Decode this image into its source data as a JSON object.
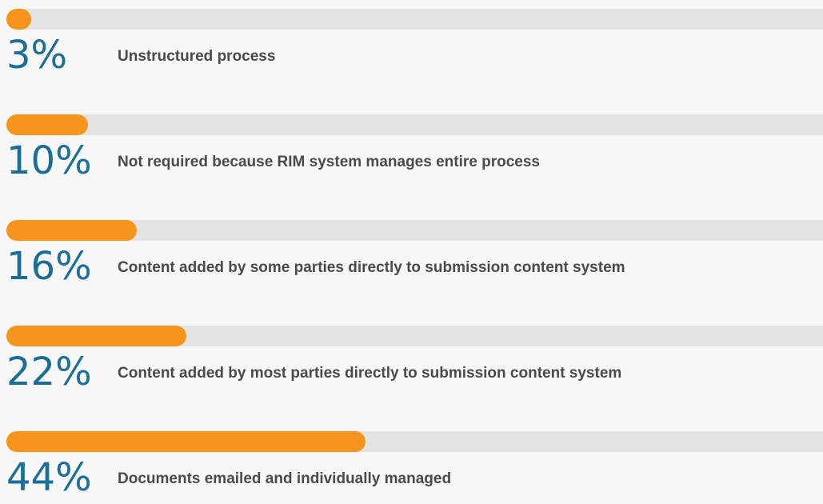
{
  "chart_data": {
    "type": "bar",
    "orientation": "horizontal",
    "categories": [
      "Unstructured process",
      "Not required because RIM system manages entire process",
      "Content added by some parties directly to submission content system",
      "Content added by most parties directly to submission content system",
      "Documents emailed and individually managed"
    ],
    "values": [
      3,
      10,
      16,
      22,
      44
    ],
    "value_labels": [
      "3%",
      "10%",
      "16%",
      "22%",
      "44%"
    ],
    "xlim": [
      0,
      100
    ],
    "grid": false,
    "legend": "none"
  },
  "colors": {
    "bar": "#f7941d",
    "track": "#e3e3e3",
    "value_text": "#1b6f97",
    "label_text": "#4a4a4a",
    "background": "#f7f7f7"
  }
}
